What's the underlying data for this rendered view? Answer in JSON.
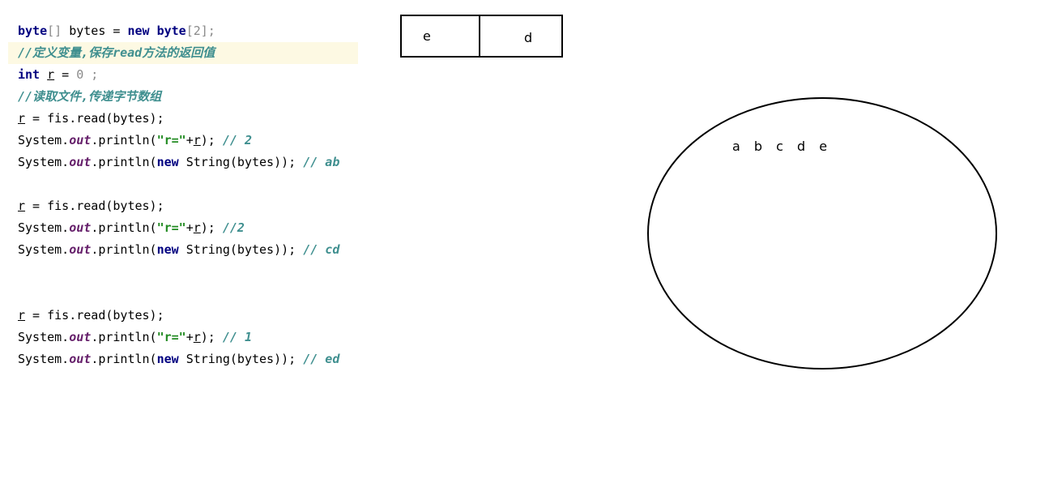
{
  "code": {
    "l1": {
      "kw1": "byte",
      "p1": "[]",
      "t1": " bytes = ",
      "kw2": "new",
      "t2": " ",
      "kw3": "byte",
      "p2": "[2];"
    },
    "l2": {
      "comment": "//定义变量,保存read方法的返回值"
    },
    "l3": {
      "kw": "int",
      "t1": " ",
      "var": "r",
      "t2": " = ",
      "num": "0",
      "p": " ;"
    },
    "l4": {
      "comment": "//读取文件,传递字节数组"
    },
    "reads": [
      {
        "read": {
          "var": "r",
          "rest": " = fis.read(bytes);"
        },
        "print_r": {
          "a": "System.",
          "out": "out",
          "b": ".println(",
          "str": "\"r=\"",
          "c": "+",
          "var": "r",
          "d": "); ",
          "comment": "// 2"
        },
        "print_s": {
          "a": "System.",
          "out": "out",
          "b": ".println(",
          "kw": "new",
          "c": " String(bytes)); ",
          "comment": "// ab"
        }
      },
      {
        "read": {
          "var": "r",
          "rest": " = fis.read(bytes);"
        },
        "print_r": {
          "a": "System.",
          "out": "out",
          "b": ".println(",
          "str": "\"r=\"",
          "c": "+",
          "var": "r",
          "d": "); ",
          "comment": "//2"
        },
        "print_s": {
          "a": "System.",
          "out": "out",
          "b": ".println(",
          "kw": "new",
          "c": " String(bytes)); ",
          "comment": "// cd"
        }
      },
      {
        "read": {
          "var": "r",
          "rest": " = fis.read(bytes);"
        },
        "print_r": {
          "a": "System.",
          "out": "out",
          "b": ".println(",
          "str": "\"r=\"",
          "c": "+",
          "var": "r",
          "d": "); ",
          "comment": "// 1"
        },
        "print_s": {
          "a": "System.",
          "out": "out",
          "b": ".println(",
          "kw": "new",
          "c": " String(bytes)); ",
          "comment": "// ed"
        }
      }
    ]
  },
  "byte_array": {
    "cells": [
      "e",
      "d"
    ]
  },
  "file": {
    "content": "a b c d e"
  }
}
